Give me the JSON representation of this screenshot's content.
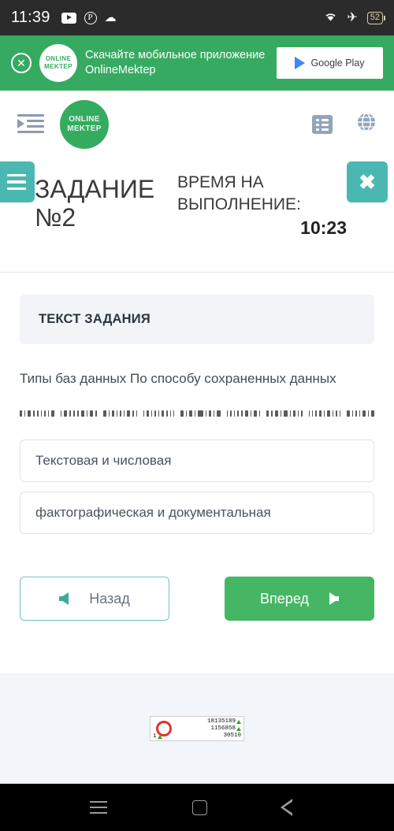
{
  "status_bar": {
    "time": "11:39",
    "icons": [
      "youtube-icon",
      "pinterest-icon",
      "cloud-icon"
    ],
    "pinterest_glyph": "P",
    "cloud_glyph": "☁",
    "wifi_glyph": "◠",
    "airplane_glyph": "✈",
    "battery_level": "52"
  },
  "promo_banner": {
    "close_glyph": "✕",
    "logo_line1": "ONLINE",
    "logo_line2": "MEKTEP",
    "text": "Скачайте мобильное приложение OnlineMektep",
    "store_button_label": "Google Play",
    "background_color": "#37aa61"
  },
  "site_header": {
    "menu_icon_name": "indent-menu-icon",
    "logo_line1": "ONLINE",
    "logo_line2": "MEKTEP",
    "list_icon_name": "list-icon",
    "globe_glyph": "ἱ0"
  },
  "task_header": {
    "menu_button_name": "hamburger-menu",
    "close_button_glyph": "✖",
    "title": "ЗАДАНИЕ №2",
    "time_label": "ВРЕМЯ НА ВЫПОЛНЕНИЕ:",
    "time_value": "10:23",
    "accent_color": "#4ab8b0"
  },
  "content": {
    "section_title": "ТЕКСТ ЗАДАНИЯ",
    "question": "Типы баз данных По способу сохраненных данных",
    "redacted_note": "",
    "options": [
      "Текстовая и числовая",
      "фактографическая и документальная"
    ],
    "back_button": "Назад",
    "forward_button": "Вперед",
    "forward_color": "#45b764"
  },
  "footer": {
    "counter": {
      "row1": "18135189",
      "row2": "1156858",
      "row3": "30510",
      "corner": "1"
    }
  },
  "android_nav": {
    "recents": "recents-button",
    "home": "home-button",
    "back": "back-button"
  }
}
